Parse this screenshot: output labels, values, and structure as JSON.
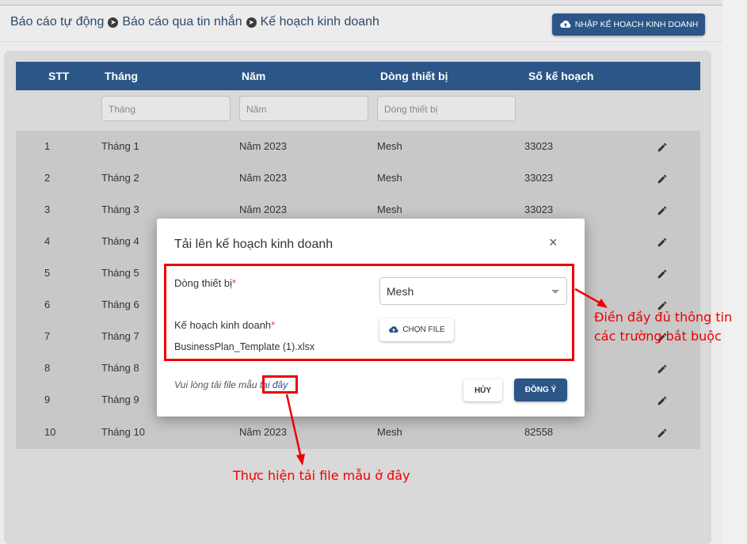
{
  "breadcrumb": [
    "Báo cáo tự động",
    "Báo cáo qua tin nhắn",
    "Kế hoạch kinh doanh"
  ],
  "header": {
    "import_button": "NHẬP KẾ HOẠCH KINH DOANH",
    "import_icon": "cloud-upload-icon"
  },
  "table": {
    "columns": [
      "STT",
      "Tháng",
      "Năm",
      "Dòng thiết bị",
      "Số kế hoạch"
    ],
    "filters": {
      "month": "Tháng",
      "year": "Năm",
      "device": "Dòng thiết bị"
    },
    "rows": [
      [
        "1",
        "Tháng 1",
        "Năm 2023",
        "Mesh",
        "33023"
      ],
      [
        "2",
        "Tháng 2",
        "Năm 2023",
        "Mesh",
        "33023"
      ],
      [
        "3",
        "Tháng 3",
        "Năm 2023",
        "Mesh",
        "33023"
      ],
      [
        "4",
        "Tháng 4",
        "",
        "",
        ""
      ],
      [
        "5",
        "Tháng 5",
        "",
        "",
        ""
      ],
      [
        "6",
        "Tháng 6",
        "",
        "",
        ""
      ],
      [
        "7",
        "Tháng 7",
        "",
        "",
        ""
      ],
      [
        "8",
        "Tháng 8",
        "",
        "",
        ""
      ],
      [
        "9",
        "Tháng 9",
        "",
        "",
        ""
      ],
      [
        "10",
        "Tháng 10",
        "Năm 2023",
        "Mesh",
        "82558"
      ]
    ]
  },
  "modal": {
    "title": "Tải lên kế hoạch kinh doanh",
    "close": "×",
    "device_label": "Dòng thiết bị",
    "required_mark": "*",
    "device_value": "Mesh",
    "plan_label": "Kế hoạch kinh doanh",
    "choose_file": "CHỌN FILE",
    "filename": "BusinessPlan_Template (1).xlsx",
    "hint_prefix": "Vui lòng tải file mẫu ",
    "hint_link": "tại đây",
    "cancel": "HỦY",
    "ok": "ĐỒNG Ý"
  },
  "annotations": {
    "fill_required": [
      "Điền đầy đủ thông tin",
      "các trường bắt buộc"
    ],
    "download_template": "Thực hiện tải file mẫu ở đây"
  },
  "colors": {
    "primary": "#2b5687",
    "annotation": "#ee0000",
    "required": "#e53935"
  }
}
